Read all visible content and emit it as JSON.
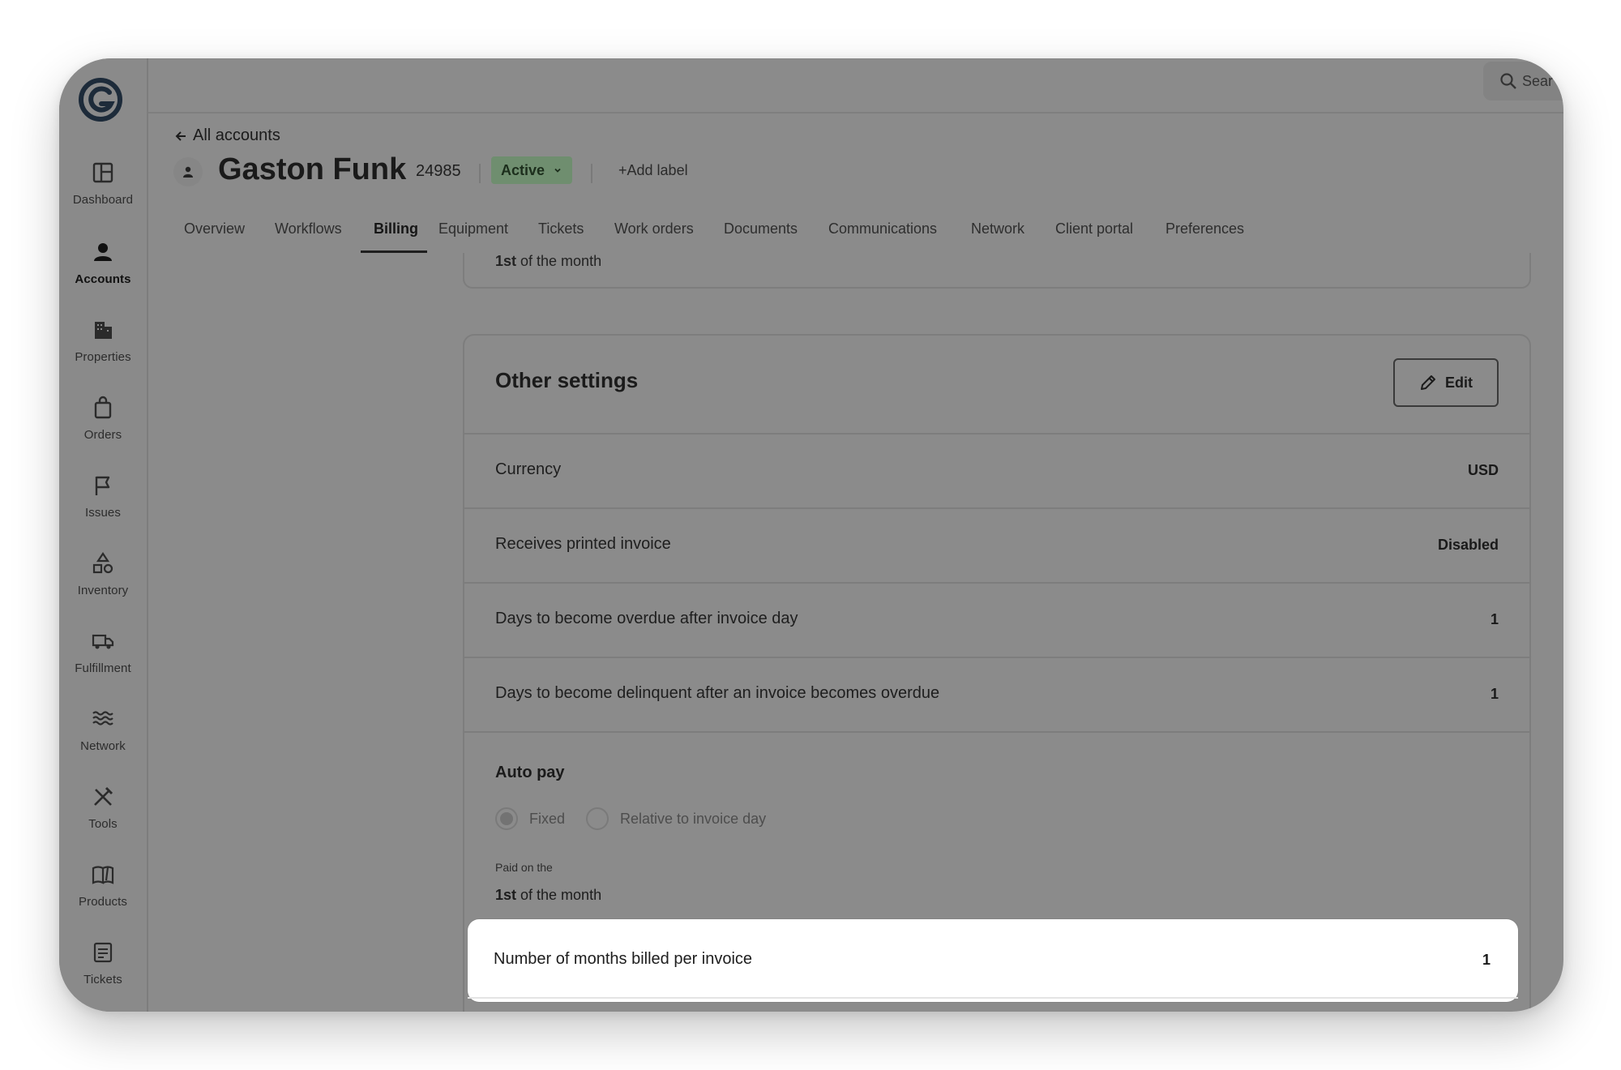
{
  "app": {
    "brand_color": "#1d2b3a",
    "search_placeholder": "Sear"
  },
  "sidebar": {
    "items": [
      {
        "label": "Dashboard",
        "icon": "dashboard-icon"
      },
      {
        "label": "Accounts",
        "icon": "person-icon",
        "active": true
      },
      {
        "label": "Properties",
        "icon": "building-icon"
      },
      {
        "label": "Orders",
        "icon": "shopping-bag-icon"
      },
      {
        "label": "Issues",
        "icon": "flag-icon"
      },
      {
        "label": "Inventory",
        "icon": "shapes-icon"
      },
      {
        "label": "Fulfillment",
        "icon": "truck-icon"
      },
      {
        "label": "Network",
        "icon": "waves-icon"
      },
      {
        "label": "Tools",
        "icon": "tools-icon"
      },
      {
        "label": "Products",
        "icon": "book-icon"
      },
      {
        "label": "Tickets",
        "icon": "ticket-icon"
      }
    ]
  },
  "header": {
    "back_label": "All accounts",
    "account_name": "Gaston Funk",
    "account_id": "24985",
    "status": "Active",
    "add_label": "Add label"
  },
  "tabs": [
    {
      "label": "Overview"
    },
    {
      "label": "Workflows"
    },
    {
      "label": "Billing",
      "active": true
    },
    {
      "label": "Equipment"
    },
    {
      "label": "Tickets"
    },
    {
      "label": "Work orders"
    },
    {
      "label": "Documents"
    },
    {
      "label": "Communications"
    },
    {
      "label": "Network"
    },
    {
      "label": "Client portal"
    },
    {
      "label": "Preferences"
    }
  ],
  "previous_card": {
    "day_bold": "1st",
    "day_rest": " of the month"
  },
  "other_settings": {
    "title": "Other settings",
    "edit_label": "Edit",
    "rows": [
      {
        "label": "Currency",
        "value": "USD"
      },
      {
        "label": "Receives printed invoice",
        "value": "Disabled"
      },
      {
        "label": "Days to become overdue after invoice day",
        "value": "1"
      },
      {
        "label": "Days to become delinquent after an invoice becomes overdue",
        "value": "1"
      }
    ],
    "auto_pay": {
      "title": "Auto pay",
      "options": [
        {
          "label": "Fixed",
          "selected": true
        },
        {
          "label": "Relative to invoice day",
          "selected": false
        }
      ],
      "paid_on_label": "Paid on the",
      "paid_on_day_bold": "1st",
      "paid_on_day_rest": " of the month"
    },
    "highlighted_row": {
      "label": "Number of months billed per invoice",
      "value": "1"
    }
  }
}
